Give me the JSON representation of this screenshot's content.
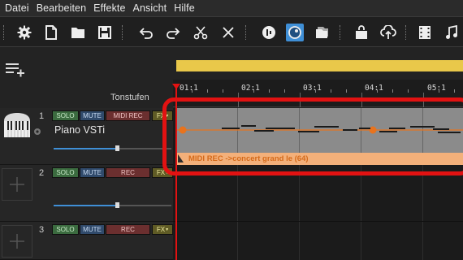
{
  "menu": [
    "Datei",
    "Bearbeiten",
    "Effekte",
    "Ansicht",
    "Hilfe"
  ],
  "toolbar_icons": [
    "gear-icon",
    "new-file-icon",
    "open-folder-icon",
    "save-icon",
    "undo-icon",
    "redo-icon",
    "cut-icon",
    "delete-icon",
    "audio-icon",
    "dial-icon",
    "folder-icon",
    "shop-icon",
    "cloud-upload-icon",
    "film-icon",
    "music-note-icon"
  ],
  "header": {
    "tonstufen": "Tonstufen"
  },
  "ruler": {
    "labels": [
      "01:1",
      "02:1",
      "03:1",
      "04:1",
      "05:1"
    ]
  },
  "tracks": [
    {
      "num": "1",
      "solo": "SOLO",
      "mute": "MUTE",
      "rec": "MIDI REC",
      "fx": "FX",
      "name": "Piano VSTi"
    },
    {
      "num": "2",
      "solo": "SOLO",
      "mute": "MUTE",
      "rec": "REC",
      "fx": "FX",
      "name": ""
    },
    {
      "num": "3",
      "solo": "SOLO",
      "mute": "MUTE",
      "rec": "REC",
      "fx": "FX",
      "name": ""
    }
  ],
  "clip": {
    "label": "MIDI REC ->concert grand le (64)"
  },
  "colors": {
    "accent": "#3f8fd6",
    "highlight": "#e21212",
    "loop": "#e9c84a",
    "clip_footer": "#f3b07a"
  }
}
